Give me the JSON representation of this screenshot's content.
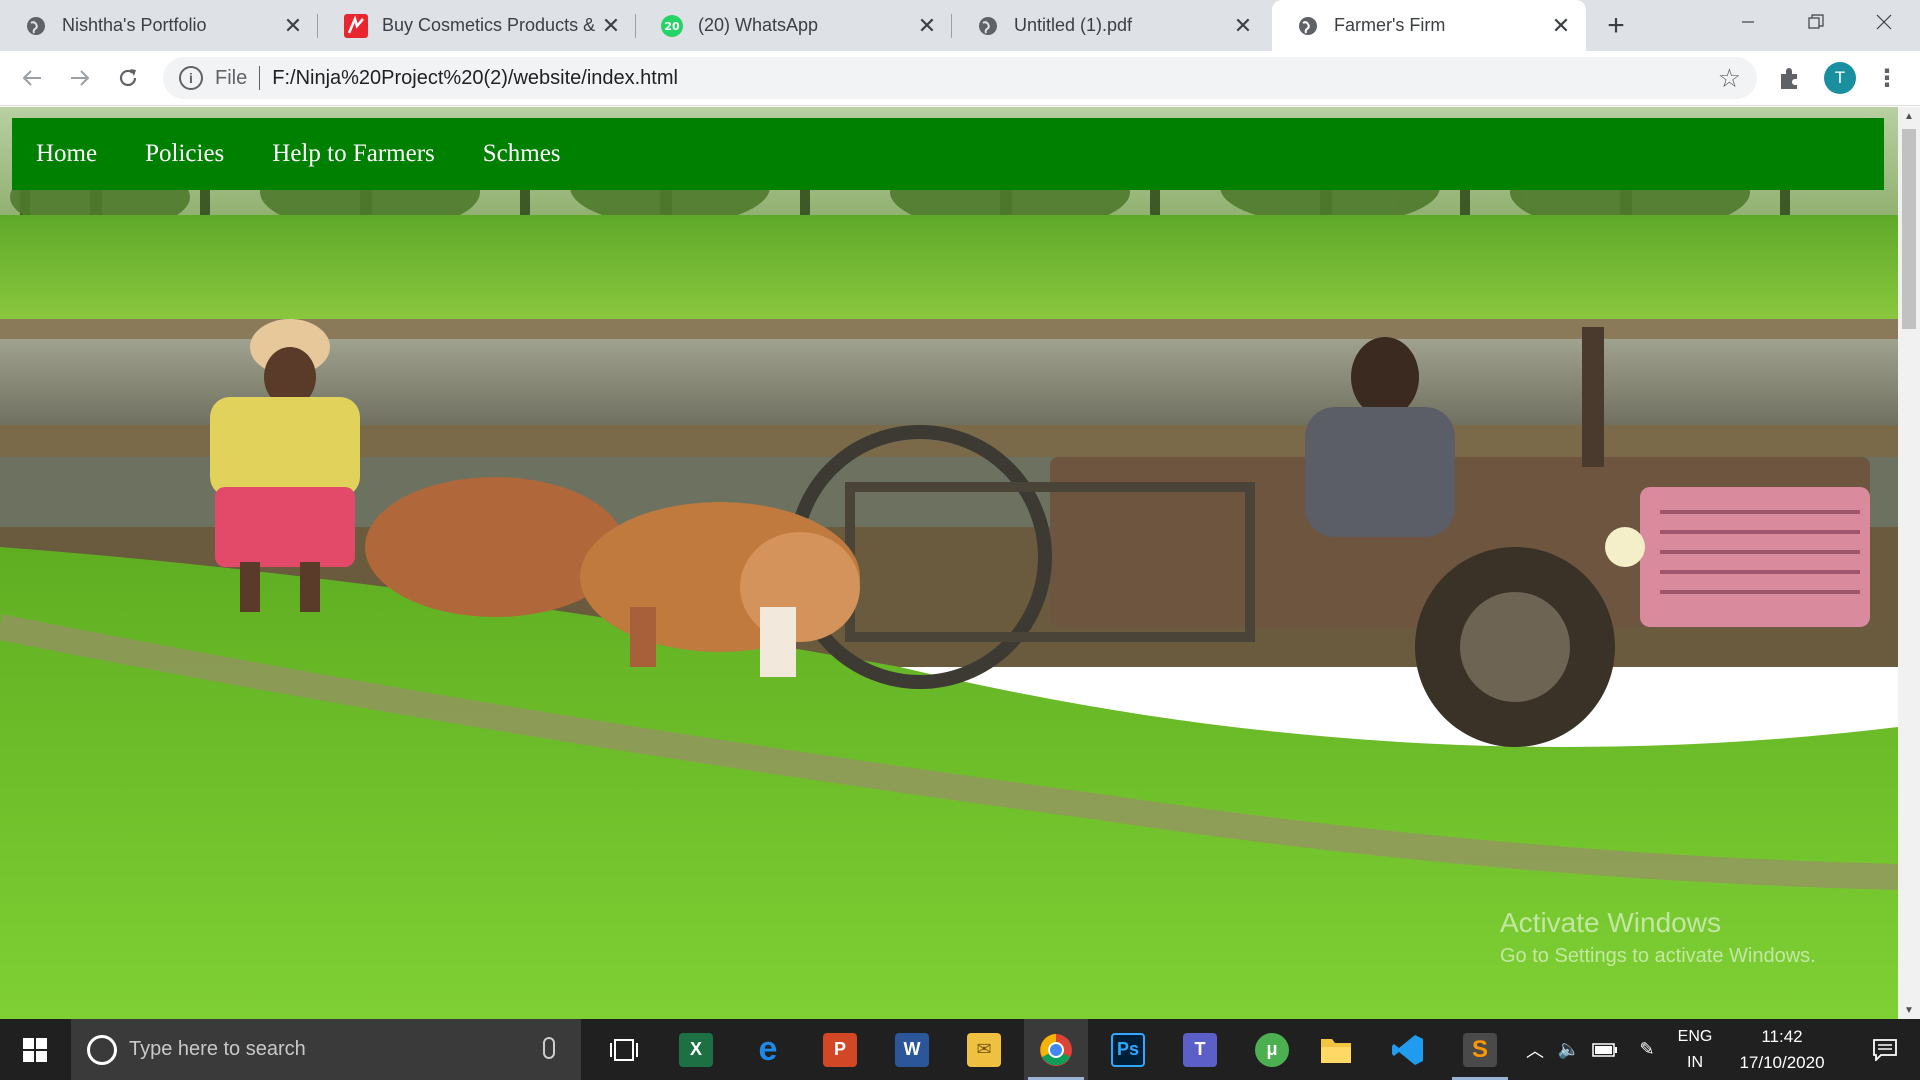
{
  "browser": {
    "tabs": [
      {
        "title": "Nishtha's Portfolio",
        "favicon": "globe-icon"
      },
      {
        "title": "Buy Cosmetics Products & B",
        "favicon": "nykaa-icon"
      },
      {
        "title": "(20) WhatsApp",
        "favicon": "whatsapp-icon",
        "badge": "20"
      },
      {
        "title": "Untitled (1).pdf",
        "favicon": "globe-icon"
      },
      {
        "title": "Farmer's Firm",
        "favicon": "globe-icon",
        "active": true
      }
    ],
    "address": {
      "scheme_label": "File",
      "url": "F:/Ninja%20Project%20(2)/website/index.html"
    },
    "profile_initial": "T"
  },
  "page": {
    "nav": [
      "Home",
      "Policies",
      "Help to Farmers",
      "Schmes"
    ],
    "nav_bg": "#008000",
    "watermark_line1": "Activate Windows",
    "watermark_line2": "Go to Settings to activate Windows."
  },
  "taskbar": {
    "search_placeholder": "Type here to search",
    "apps": [
      "task-view-icon",
      "excel-icon",
      "edge-icon",
      "powerpoint-icon",
      "word-icon",
      "outlook-icon",
      "chrome-icon",
      "photoshop-icon",
      "teams-icon",
      "utorrent-icon",
      "file-explorer-icon",
      "vscode-icon",
      "sublime-icon"
    ],
    "lang_line1": "ENG",
    "lang_line2": "IN",
    "time": "11:42",
    "date": "17/10/2020"
  }
}
